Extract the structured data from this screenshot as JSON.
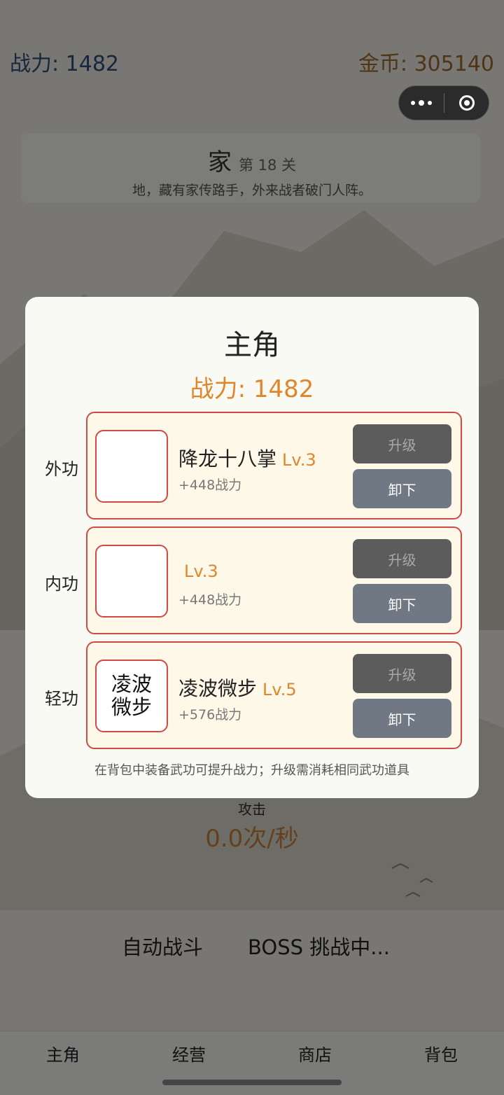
{
  "header": {
    "power_label": "战力: 1482",
    "gold_label": "金币: 305140"
  },
  "stage": {
    "name": "家",
    "number": "第 18 关",
    "description": "地，藏有家传路手，外来战者破门人阵。"
  },
  "battle": {
    "attack_label": "攻击",
    "attack_value": "0.0次/秒",
    "auto_battle": "自动战斗",
    "boss_status": "BOSS 挑战中..."
  },
  "tabs": [
    "主角",
    "经营",
    "商店",
    "背包"
  ],
  "modal": {
    "title": "主角",
    "power": "战力: 1482",
    "hint": "在背包中装备武功可提升战力；升级需消耗相同武功道具",
    "slots": [
      {
        "category": "外功",
        "icon_text": "",
        "name": "降龙十八掌",
        "level": "Lv.3",
        "bonus": "+448战力",
        "upgrade": "升级",
        "unequip": "卸下"
      },
      {
        "category": "内功",
        "icon_text": "",
        "name": "",
        "level": "Lv.3",
        "bonus": "+448战力",
        "upgrade": "升级",
        "unequip": "卸下"
      },
      {
        "category": "轻功",
        "icon_text": "凌波\n微步",
        "name": "凌波微步",
        "level": "Lv.5",
        "bonus": "+576战力",
        "upgrade": "升级",
        "unequip": "卸下"
      }
    ]
  },
  "colors": {
    "accent": "#e0862a",
    "slot_border": "#cf4a43",
    "slot_bg": "#fdf8e8",
    "power_top": "#2f4f7a",
    "gold_top": "#9a6a2a"
  }
}
